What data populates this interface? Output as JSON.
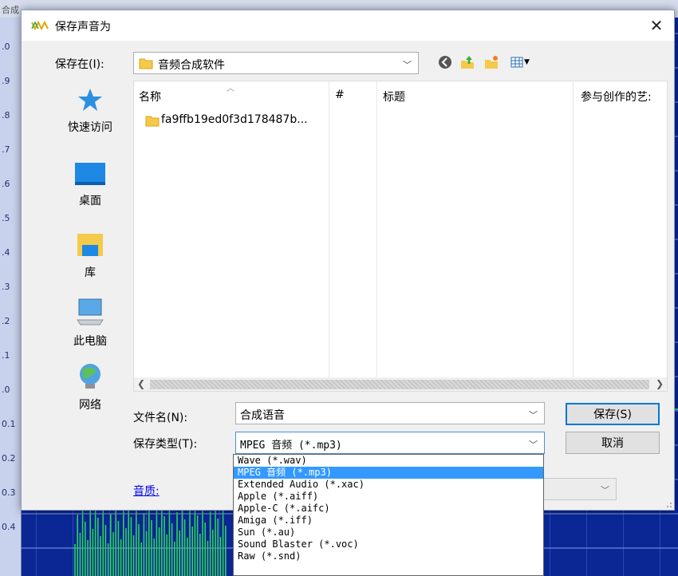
{
  "background_app": {
    "top_label": "合成",
    "ruler_labels": [
      ".0",
      ".9",
      ".8",
      ".7",
      ".6",
      ".5",
      ".4",
      ".3",
      ".2",
      ".1",
      ".0",
      "0.1",
      "0.2",
      "0.3",
      "0.4"
    ]
  },
  "dialog": {
    "title": "保存声音为",
    "close_glyph": "✕"
  },
  "save_in": {
    "label": "保存在(I):",
    "value": "音频合成软件"
  },
  "places": [
    {
      "label": "快速访问",
      "icon": "star-icon"
    },
    {
      "label": "桌面",
      "icon": "desktop-icon"
    },
    {
      "label": "库",
      "icon": "library-icon"
    },
    {
      "label": "此电脑",
      "icon": "computer-icon"
    },
    {
      "label": "网络",
      "icon": "network-icon"
    }
  ],
  "file_list": {
    "columns": [
      "名称",
      "#",
      "标题",
      "参与创作的艺:"
    ],
    "rows": [
      {
        "name": "fa9ffb19ed0f3d178487b..."
      }
    ]
  },
  "filename": {
    "label": "文件名(N):",
    "value": "合成语音"
  },
  "filetype": {
    "label": "保存类型(T):",
    "value": "MPEG 音频 (*.mp3)",
    "options": [
      "Wave (*.wav)",
      "MPEG 音频 (*.mp3)",
      "Extended Audio (*.xac)",
      "Apple (*.aiff)",
      "Apple-C (*.aifc)",
      "Amiga (*.iff)",
      "Sun (*.au)",
      "Sound Blaster (*.voc)",
      "Raw (*.snd)"
    ],
    "selected_index": 1
  },
  "buttons": {
    "save": "保存(S)",
    "cancel": "取消"
  },
  "quality": {
    "label": "音质:"
  },
  "colors": {
    "accent": "#0078d7",
    "selection": "#3399ff",
    "waveform": "#2dd35a",
    "editor_bg": "#0b2794"
  }
}
